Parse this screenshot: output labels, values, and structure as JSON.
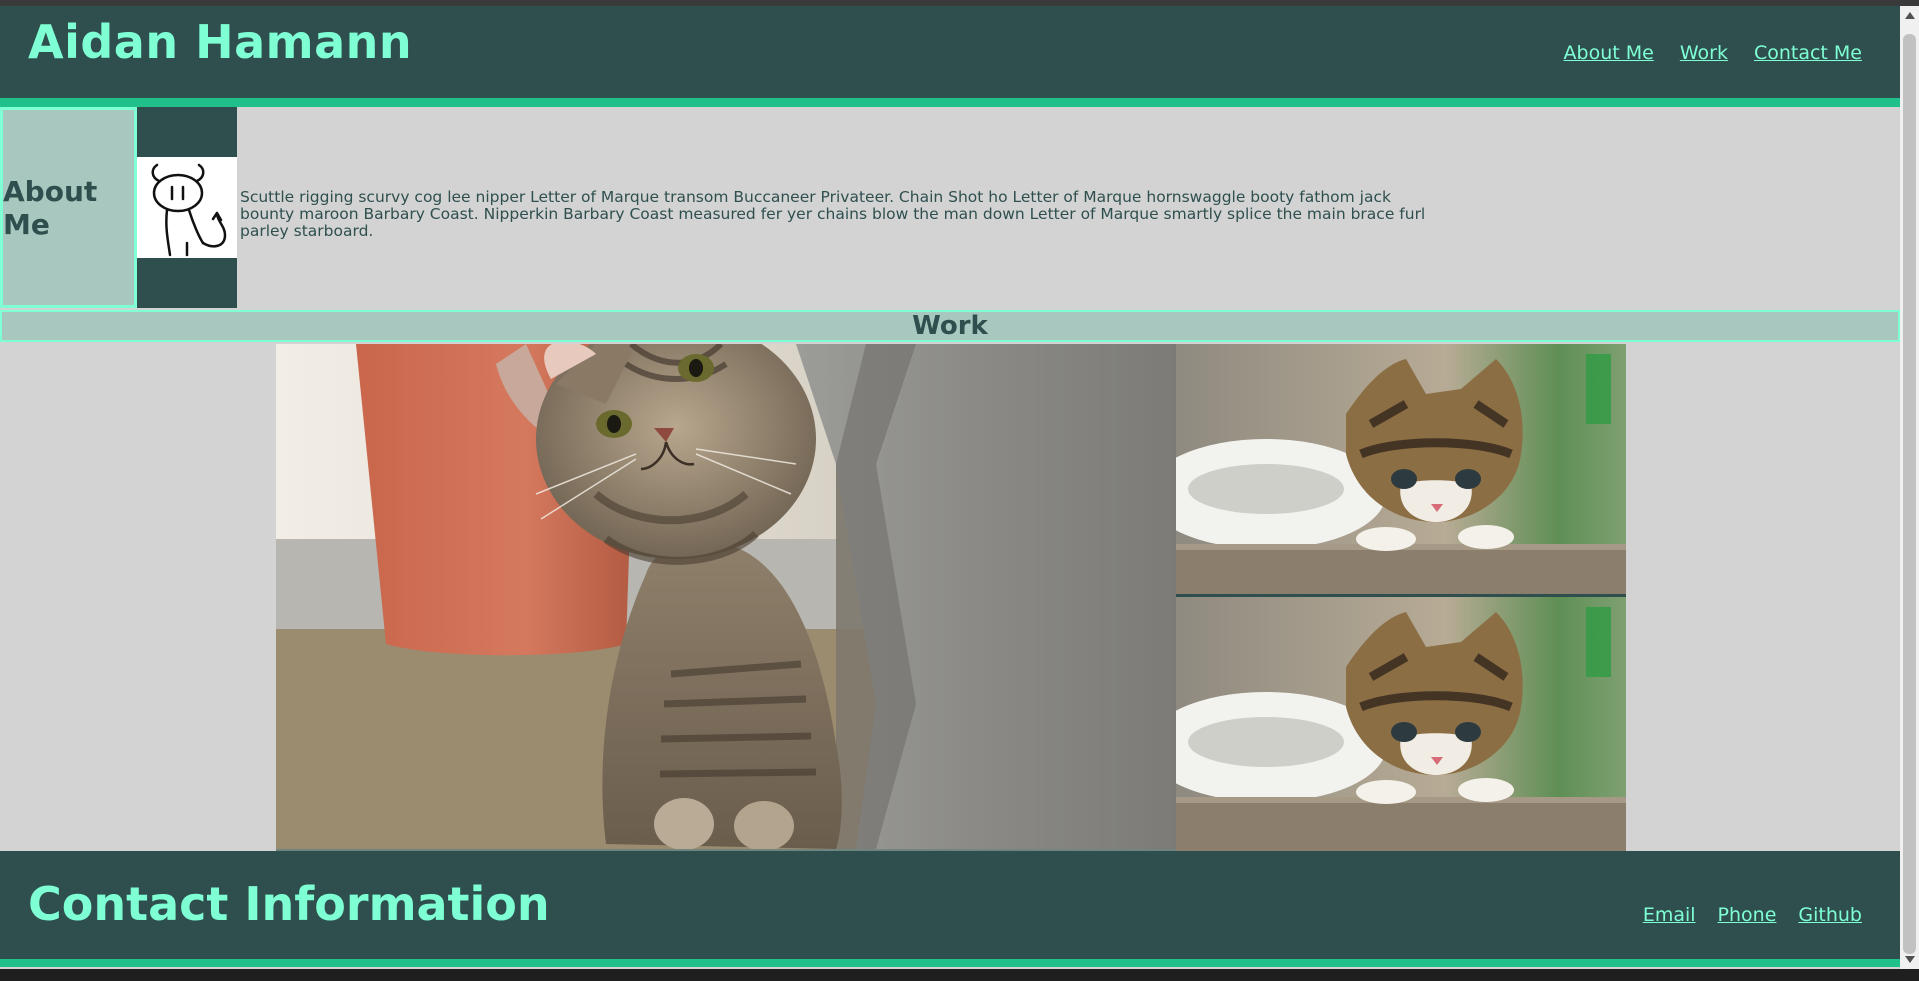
{
  "header": {
    "title": "Aidan Hamann",
    "nav": [
      "About Me",
      "Work",
      "Contact Me"
    ]
  },
  "about": {
    "heading": "About Me",
    "avatar_icon": "horned-doodle-avatar",
    "bio": "Scuttle rigging scurvy cog lee nipper Letter of Marque transom Buccaneer Privateer. Chain Shot ho Letter of Marque hornswaggle booty fathom jack bounty maroon Barbary Coast. Nipperkin Barbary Coast measured fer yer chains blow the man down Letter of Marque smartly splice the main brace furl parley starboard."
  },
  "work": {
    "heading": "Work",
    "photos": [
      "tabby-kitten-photo",
      "kitten-photo",
      "kitten-photo"
    ]
  },
  "footer": {
    "title": "Contact Information",
    "links": [
      "Email",
      "Phone",
      "Github"
    ]
  },
  "colors": {
    "dark": "#2f4f4f",
    "accent": "#7fffd4",
    "accent_border": "#1fc08a",
    "panel": "#a8c8bf",
    "background": "#d3d3d3"
  }
}
